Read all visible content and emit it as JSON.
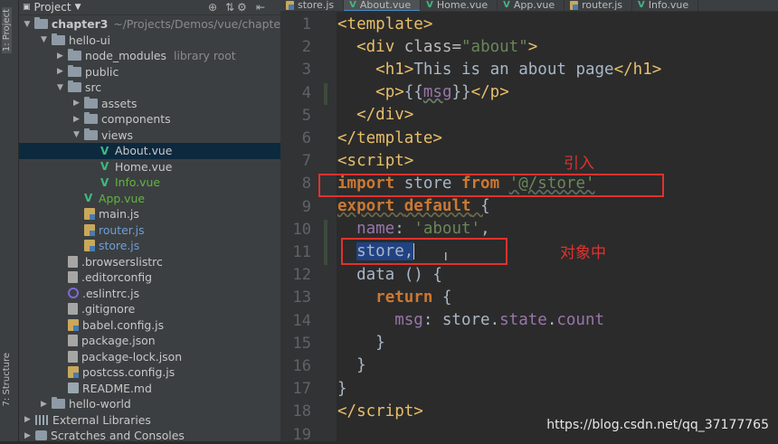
{
  "left_strip": {
    "project_tab": "1: Project",
    "structure_tab": "7: Structure"
  },
  "panel": {
    "title": "Project"
  },
  "tree": [
    {
      "label": "chapter3",
      "hint": "~/Projects/Demos/vue/chapte",
      "icon": "folder-icon",
      "depth": 0,
      "open": true
    },
    {
      "label": "hello-ui",
      "depth": 1,
      "icon": "folder-icon",
      "open": true
    },
    {
      "label": "node_modules",
      "hint": "library root",
      "depth": 2,
      "icon": "folder-icon",
      "open": false
    },
    {
      "label": "public",
      "depth": 2,
      "icon": "folder-icon",
      "open": false
    },
    {
      "label": "src",
      "depth": 2,
      "icon": "folder-icon",
      "open": true
    },
    {
      "label": "assets",
      "depth": 3,
      "icon": "folder-icon",
      "open": false
    },
    {
      "label": "components",
      "depth": 3,
      "icon": "folder-icon",
      "open": false
    },
    {
      "label": "views",
      "depth": 3,
      "icon": "folder-icon",
      "open": true
    },
    {
      "label": "About.vue",
      "depth": 4,
      "icon": "vue-icon",
      "selected": true
    },
    {
      "label": "Home.vue",
      "depth": 4,
      "icon": "vue-icon"
    },
    {
      "label": "Info.vue",
      "depth": 4,
      "icon": "vue-icon",
      "color": "green"
    },
    {
      "label": "App.vue",
      "depth": 3,
      "icon": "vue-icon",
      "color": "green"
    },
    {
      "label": "main.js",
      "depth": 3,
      "icon": "js-icon"
    },
    {
      "label": "router.js",
      "depth": 3,
      "icon": "js-icon",
      "color": "blue"
    },
    {
      "label": "store.js",
      "depth": 3,
      "icon": "js-icon",
      "color": "blue"
    },
    {
      "label": ".browserslistrc",
      "depth": 2,
      "icon": "file-icon"
    },
    {
      "label": ".editorconfig",
      "depth": 2,
      "icon": "file-icon"
    },
    {
      "label": ".eslintrc.js",
      "depth": 2,
      "icon": "eslint-icon"
    },
    {
      "label": ".gitignore",
      "depth": 2,
      "icon": "file-icon"
    },
    {
      "label": "babel.config.js",
      "depth": 2,
      "icon": "js-icon"
    },
    {
      "label": "package.json",
      "depth": 2,
      "icon": "file-icon"
    },
    {
      "label": "package-lock.json",
      "depth": 2,
      "icon": "file-icon"
    },
    {
      "label": "postcss.config.js",
      "depth": 2,
      "icon": "js-icon"
    },
    {
      "label": "README.md",
      "depth": 2,
      "icon": "md-icon"
    },
    {
      "label": "hello-world",
      "depth": 1,
      "icon": "folder-icon",
      "open": false
    },
    {
      "label": "External Libraries",
      "depth": 0,
      "icon": "libraries-icon"
    },
    {
      "label": "Scratches and Consoles",
      "depth": 0,
      "icon": "scratches-icon"
    }
  ],
  "tabs": [
    {
      "label": "store.js",
      "icon": "js-icon",
      "active": false
    },
    {
      "label": "About.vue",
      "icon": "vue-icon",
      "active": true
    },
    {
      "label": "Home.vue",
      "icon": "vue-icon",
      "active": false
    },
    {
      "label": "App.vue",
      "icon": "vue-icon",
      "active": false
    },
    {
      "label": "router.js",
      "icon": "js-icon",
      "active": false
    },
    {
      "label": "Info.vue",
      "icon": "vue-icon",
      "active": false
    }
  ],
  "code": {
    "line_numbers": [
      "1",
      "2",
      "3",
      "4",
      "5",
      "6",
      "7",
      "8",
      "9",
      "10",
      "11",
      "12",
      "13",
      "14",
      "15",
      "16",
      "17",
      "18",
      "19"
    ],
    "l1": {
      "open": "<",
      "tag": "template",
      "close": ">"
    },
    "l2": {
      "indent": "  ",
      "lt": "<",
      "tag": "div",
      "attr": " class=",
      "val": "\"about\"",
      "gt": ">"
    },
    "l3": {
      "indent": "    ",
      "lt": "<",
      "tag": "h1",
      "gt": ">",
      "text": "This is an about page",
      "lt2": "</",
      "tag2": "h1",
      "gt2": ">"
    },
    "l4": {
      "indent": "    ",
      "lt": "<",
      "tag": "p",
      "gt": ">",
      "text": "{{",
      "var": "msg",
      "text2": "}}",
      "lt2": "</",
      "tag2": "p",
      "gt2": ">"
    },
    "l5": {
      "indent": "  ",
      "lt": "</",
      "tag": "div",
      "gt": ">"
    },
    "l6": {
      "lt": "</",
      "tag": "template",
      "gt": ">"
    },
    "l7": {
      "lt": "<",
      "tag": "script",
      "gt": ">"
    },
    "l8": {
      "kw1": "import",
      "mid": " store ",
      "kw2": "from",
      "sp": " ",
      "str": "'@/store'"
    },
    "l9": {
      "kw1": "export",
      "sp": " ",
      "kw2": "default",
      "rest": " {"
    },
    "l10": {
      "indent": "  ",
      "prop": "name",
      "colon": ": ",
      "str": "'about'",
      "comma": ","
    },
    "l11": {
      "indent": "  ",
      "sel": "store,"
    },
    "l12": {
      "indent": "  ",
      "fn": "data",
      "rest": " () {"
    },
    "l13": {
      "indent": "    ",
      "kw": "return",
      "rest": " {"
    },
    "l14": {
      "indent": "      ",
      "key": "msg",
      "colon": ": store.",
      "p1": "state",
      "dot": ".",
      "p2": "count"
    },
    "l15": {
      "indent": "    ",
      "text": "}"
    },
    "l16": {
      "indent": "  ",
      "text": "}"
    },
    "l17": {
      "text": "}"
    },
    "l18": {
      "lt": "</",
      "tag": "script",
      "gt": ">"
    },
    "l19": {
      "text": ""
    }
  },
  "annotations": {
    "import_label": "引入",
    "object_label": "对象中"
  },
  "watermark": "https://blog.csdn.net/qq_37177765",
  "colors": {
    "annotation": "#e0322d",
    "vue": "#41b883",
    "selection": "#214283"
  }
}
